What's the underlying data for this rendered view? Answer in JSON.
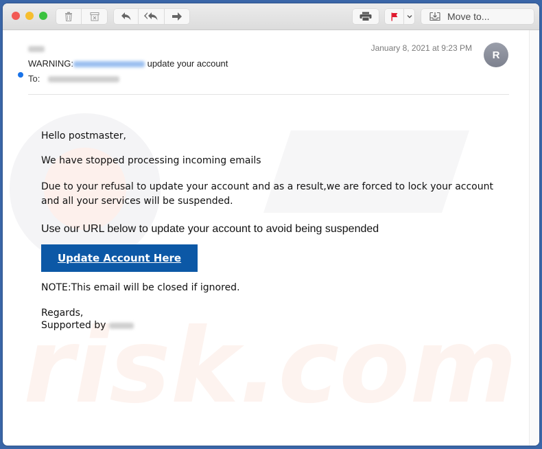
{
  "toolbar": {
    "delete_icon": "trash-icon",
    "junk_icon": "junk-icon",
    "reply_icon": "reply-icon",
    "reply_all_icon": "reply-all-icon",
    "forward_icon": "forward-icon",
    "print_icon": "printer-icon",
    "flag_icon": "flag-icon",
    "flag_color": "#e0182d",
    "move_to_label": "Move to..."
  },
  "email": {
    "sender_redacted": true,
    "subject_prefix": "WARNING:",
    "subject_suffix": "update your account",
    "to_label": "To:",
    "date": "January 8, 2021 at 9:23 PM",
    "avatar_initial": "R",
    "unread_dot_color": "#1a73e8"
  },
  "body": {
    "greeting": "Hello postmaster,",
    "line1": "We have stopped processing incoming emails",
    "line2": "Due to your refusal to update your account and as a result,we are forced to lock your account and all your services will be suspended.",
    "line3": "Use our URL below to update your account to avoid being suspended",
    "cta_label": "Update Account Here",
    "cta_color": "#0c58a6",
    "note": "NOTE:This email will be closed if ignored.",
    "regards": "Regards,",
    "supported_by": "Supported by"
  }
}
